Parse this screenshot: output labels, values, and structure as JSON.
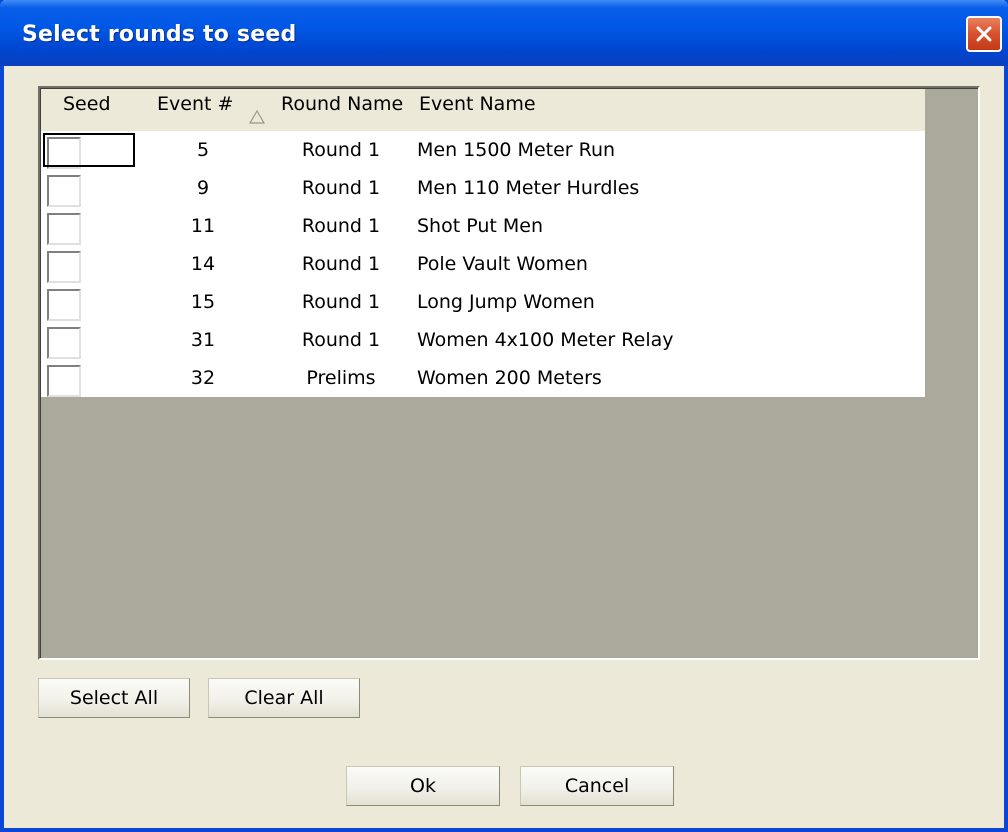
{
  "window": {
    "title": "Select rounds to seed"
  },
  "grid": {
    "columns": {
      "seed": "Seed",
      "event_num": "Event #",
      "round_name": "Round Name",
      "event_name": "Event Name"
    },
    "sort_indicator": "sort-ascending-icon",
    "rows": [
      {
        "seed": false,
        "event_num": "5",
        "round_name": "Round 1",
        "event_name": "Men 1500 Meter Run"
      },
      {
        "seed": false,
        "event_num": "9",
        "round_name": "Round 1",
        "event_name": "Men 110 Meter Hurdles"
      },
      {
        "seed": false,
        "event_num": "11",
        "round_name": "Round 1",
        "event_name": "Shot Put Men"
      },
      {
        "seed": false,
        "event_num": "14",
        "round_name": "Round 1",
        "event_name": "Pole Vault Women"
      },
      {
        "seed": false,
        "event_num": "15",
        "round_name": "Round 1",
        "event_name": "Long Jump Women"
      },
      {
        "seed": false,
        "event_num": "31",
        "round_name": "Round 1",
        "event_name": "Women 4x100 Meter Relay"
      },
      {
        "seed": false,
        "event_num": "32",
        "round_name": "Prelims",
        "event_name": "Women 200 Meters"
      }
    ]
  },
  "buttons": {
    "select_all": "Select All",
    "clear_all": "Clear All",
    "ok": "Ok",
    "cancel": "Cancel"
  },
  "colors": {
    "titlebar": "#0058e6",
    "dialog_bg": "#ece9d8",
    "grid_empty_bg": "#aaa99c",
    "close_button": "#d6512d"
  }
}
